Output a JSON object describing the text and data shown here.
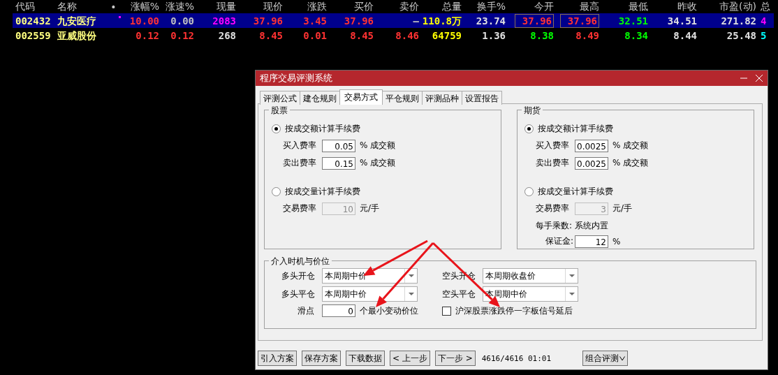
{
  "table": {
    "columns": [
      "代码",
      "名称",
      "•",
      "涨幅%",
      "涨速%",
      "现量",
      "现价",
      "涨跌",
      "买价",
      "卖价",
      "总量",
      "换手%",
      "今开",
      "最高",
      "最低",
      "昨收",
      "市盈(动)",
      "总"
    ],
    "rows": [
      {
        "selected": true,
        "cells": [
          {
            "kind": "text",
            "text": "002432",
            "color": "#ffff80",
            "boxed": false
          },
          {
            "kind": "text",
            "text": "九安医疗",
            "color": "#ffff80",
            "boxed": false
          },
          {
            "kind": "flag",
            "flagged": true
          },
          {
            "kind": "text",
            "text": "10.00",
            "color": "#ff3232",
            "boxed": false
          },
          {
            "kind": "text",
            "text": "0.00",
            "color": "#c0c0c0",
            "boxed": false
          },
          {
            "kind": "text",
            "text": "2083",
            "color": "#ff00ff",
            "boxed": false
          },
          {
            "kind": "text",
            "text": "37.96",
            "color": "#ff3232",
            "boxed": false
          },
          {
            "kind": "text",
            "text": "3.45",
            "color": "#ff3232",
            "boxed": false
          },
          {
            "kind": "text",
            "text": "37.96",
            "color": "#ff3232",
            "boxed": false
          },
          {
            "kind": "text",
            "text": "—",
            "color": "#c0c0c0",
            "boxed": false
          },
          {
            "kind": "text",
            "text": "110.8万",
            "color": "#ffff00",
            "boxed": false
          },
          {
            "kind": "text",
            "text": "23.74",
            "color": "#e0e0e0",
            "boxed": false
          },
          {
            "kind": "text",
            "text": "37.96",
            "color": "#ff3232",
            "boxed": true
          },
          {
            "kind": "text",
            "text": "37.96",
            "color": "#ff3232",
            "boxed": true
          },
          {
            "kind": "text",
            "text": "32.51",
            "color": "#00ff00",
            "boxed": false
          },
          {
            "kind": "text",
            "text": "34.51",
            "color": "#e0e0e0",
            "boxed": false
          },
          {
            "kind": "text",
            "text": "271.82",
            "color": "#e0e0e0",
            "boxed": false
          },
          {
            "kind": "text",
            "text": "4",
            "color": "#ff00ff",
            "boxed": false
          }
        ]
      },
      {
        "selected": false,
        "cells": [
          {
            "kind": "text",
            "text": "002559",
            "color": "#ffff80",
            "boxed": false
          },
          {
            "kind": "text",
            "text": "亚威股份",
            "color": "#ffff80",
            "boxed": false
          },
          {
            "kind": "flag",
            "flagged": false
          },
          {
            "kind": "text",
            "text": "0.12",
            "color": "#ff3232",
            "boxed": false
          },
          {
            "kind": "text",
            "text": "0.12",
            "color": "#ff3232",
            "boxed": false
          },
          {
            "kind": "text",
            "text": "268",
            "color": "#e0e0e0",
            "boxed": false
          },
          {
            "kind": "text",
            "text": "8.45",
            "color": "#ff3232",
            "boxed": false
          },
          {
            "kind": "text",
            "text": "0.01",
            "color": "#ff3232",
            "boxed": false
          },
          {
            "kind": "text",
            "text": "8.45",
            "color": "#ff3232",
            "boxed": false
          },
          {
            "kind": "text",
            "text": "8.46",
            "color": "#ff3232",
            "boxed": false
          },
          {
            "kind": "text",
            "text": "64759",
            "color": "#ffff00",
            "boxed": false
          },
          {
            "kind": "text",
            "text": "1.36",
            "color": "#e0e0e0",
            "boxed": false
          },
          {
            "kind": "text",
            "text": "8.38",
            "color": "#00ff00",
            "boxed": false
          },
          {
            "kind": "text",
            "text": "8.49",
            "color": "#ff3232",
            "boxed": false
          },
          {
            "kind": "text",
            "text": "8.34",
            "color": "#00ff00",
            "boxed": false
          },
          {
            "kind": "text",
            "text": "8.44",
            "color": "#e0e0e0",
            "boxed": false
          },
          {
            "kind": "text",
            "text": "25.48",
            "color": "#e0e0e0",
            "boxed": false
          },
          {
            "kind": "text",
            "text": "5",
            "color": "#00ffff",
            "boxed": false
          }
        ]
      }
    ]
  },
  "dialog": {
    "title": "程序交易评测系统",
    "tabs": [
      {
        "label": "评测公式",
        "selected": false
      },
      {
        "label": "建仓规则",
        "selected": false
      },
      {
        "label": "交易方式",
        "selected": true
      },
      {
        "label": "平仓规则",
        "selected": false
      },
      {
        "label": "评测品种",
        "selected": false
      },
      {
        "label": "设置报告",
        "selected": false
      }
    ],
    "groups": [
      {
        "legend": "股票",
        "options": [
          {
            "label": "按成交额计算手续费",
            "selected": true,
            "fields": [
              {
                "label": "买入费率",
                "value": "0.05",
                "unit": "% 成交额",
                "disabled": false
              },
              {
                "label": "卖出费率",
                "value": "0.15",
                "unit": "% 成交额",
                "disabled": false
              }
            ]
          },
          {
            "label": "按成交量计算手续费",
            "selected": false,
            "fields": [
              {
                "label": "交易费率",
                "value": "10",
                "unit": "元/手",
                "disabled": true
              }
            ]
          }
        ]
      },
      {
        "legend": "期货",
        "options": [
          {
            "label": "按成交额计算手续费",
            "selected": true,
            "fields": [
              {
                "label": "买入费率",
                "value": "0.0025",
                "unit": "% 成交额",
                "disabled": false
              },
              {
                "label": "卖出费率",
                "value": "0.0025",
                "unit": "% 成交额",
                "disabled": false
              }
            ]
          },
          {
            "label": "按成交量计算手续费",
            "selected": false,
            "fields": [
              {
                "label": "交易费率",
                "value": "3",
                "unit": "元/手",
                "disabled": true
              }
            ]
          }
        ],
        "extras": [
          {
            "kind": "note",
            "text": "每手乘数: 系统内置"
          },
          {
            "kind": "field",
            "label": "保证金:",
            "value": "12",
            "unit": "%"
          }
        ]
      }
    ],
    "entry": {
      "legend": "介入时机与价位",
      "selects": [
        {
          "label": "多头开仓",
          "value": "本周期中价"
        },
        {
          "label": "空头开仓",
          "value": "本周期收盘价"
        },
        {
          "label": "多头平仓",
          "value": "本周期中价"
        },
        {
          "label": "空头平仓",
          "value": "本周期中价"
        }
      ],
      "slippage": {
        "label": "滑点",
        "value": "0",
        "unit": "个最小变动价位"
      },
      "checkbox": {
        "label": "沪深股票涨跌停一字板信号延后",
        "checked": false
      }
    },
    "buttons": [
      "引入方案",
      "保存方案",
      "下载数据",
      "< 上一步",
      "下一步 >"
    ],
    "status": "4616/4616 01:01",
    "menu_button": "组合评测"
  }
}
